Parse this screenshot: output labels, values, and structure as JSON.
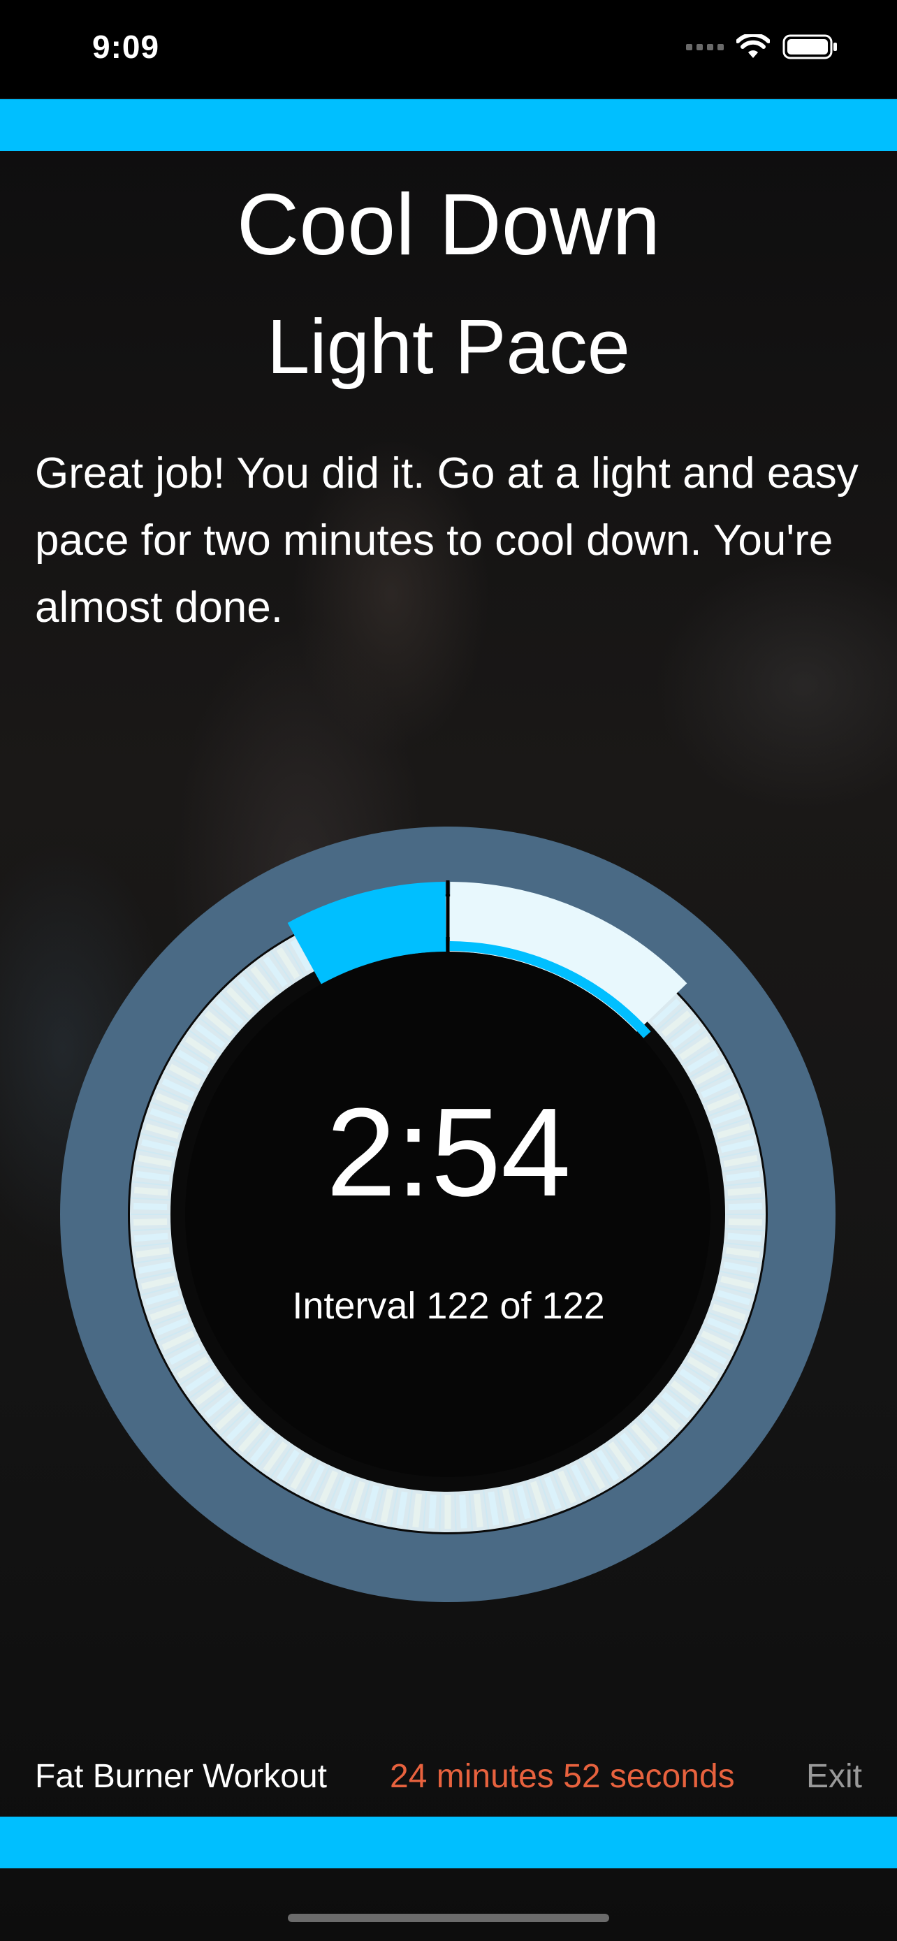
{
  "status_bar": {
    "time": "9:09",
    "icons": [
      "signal-icon",
      "wifi-icon",
      "battery-icon"
    ]
  },
  "workout": {
    "phase_title": "Cool Down",
    "intensity": "Light Pace",
    "description": "Great job! You did it. Go at a light and easy pace for two minutes to cool down. You're almost done.",
    "timer": "2:54",
    "interval_text": "Interval 122 of 122",
    "interval_progress": 0.08,
    "workout_name": "Fat Burner Workout",
    "total_remaining": "24 minutes 52 seconds",
    "exit_label": "Exit"
  },
  "colors": {
    "accent": "#00BFFF",
    "ring_outer": "#4A6A85",
    "track": "#E6F6FC",
    "tick_blue": "#17AEEA",
    "tick_gold": "#F4B400",
    "elapsed_time": "#E8623E",
    "exit": "#9A9A9A"
  }
}
